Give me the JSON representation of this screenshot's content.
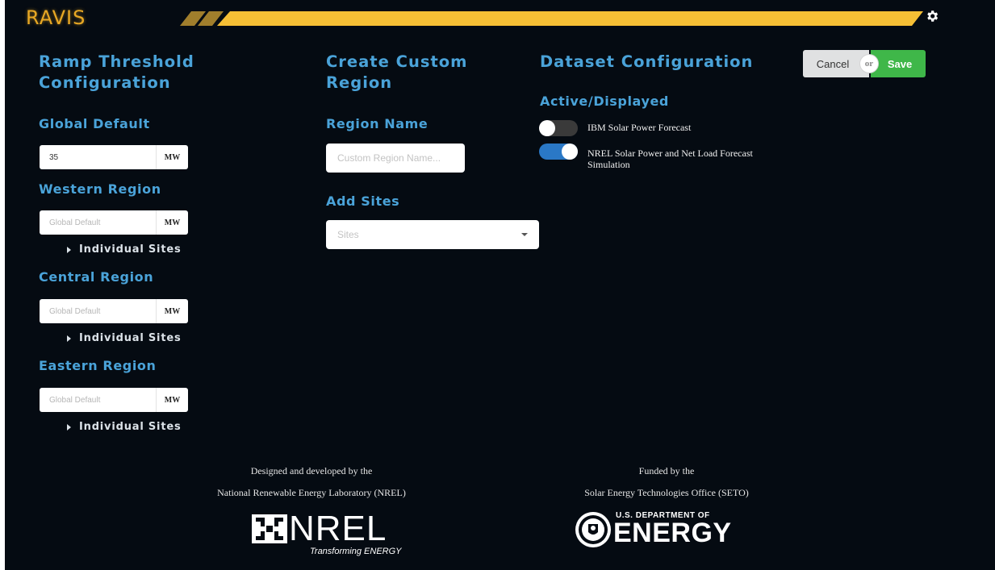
{
  "header": {
    "app_name": "RAVIS",
    "accent_color": "#f6bf35",
    "settings_icon": "gear-icon"
  },
  "ramp": {
    "title": "Ramp Threshold Configuration",
    "global": {
      "label": "Global Default",
      "value": "35",
      "unit": "MW"
    },
    "regions": [
      {
        "label": "Western Region",
        "placeholder": "Global Default",
        "unit": "MW",
        "sites_label": "Individual Sites"
      },
      {
        "label": "Central Region",
        "placeholder": "Global Default",
        "unit": "MW",
        "sites_label": "Individual Sites"
      },
      {
        "label": "Eastern Region",
        "placeholder": "Global Default",
        "unit": "MW",
        "sites_label": "Individual Sites"
      }
    ]
  },
  "custom_region": {
    "title": "Create Custom Region",
    "name_label": "Region Name",
    "name_placeholder": "Custom Region Name...",
    "sites_label": "Add Sites",
    "sites_placeholder": "Sites"
  },
  "dataset": {
    "title": "Dataset Configuration",
    "subtitle": "Active/Displayed",
    "items": [
      {
        "label": "IBM Solar Power Forecast",
        "active": false
      },
      {
        "label": "NREL Solar Power and Net Load Forecast Simulation",
        "active": true
      }
    ]
  },
  "actions": {
    "cancel_label": "Cancel",
    "or_label": "or",
    "save_label": "Save",
    "save_color": "#3fb749"
  },
  "footer": {
    "left_line1": "Designed and developed by the",
    "left_line2": "National Renewable Energy Laboratory (NREL)",
    "nrel_word": "NREL",
    "nrel_tagline": "Transforming ENERGY",
    "right_line1": "Funded by the",
    "right_line2": "Solar Energy Technologies Office (SETO)",
    "doe_top": "U.S. DEPARTMENT OF",
    "doe_main": "ENERGY"
  }
}
